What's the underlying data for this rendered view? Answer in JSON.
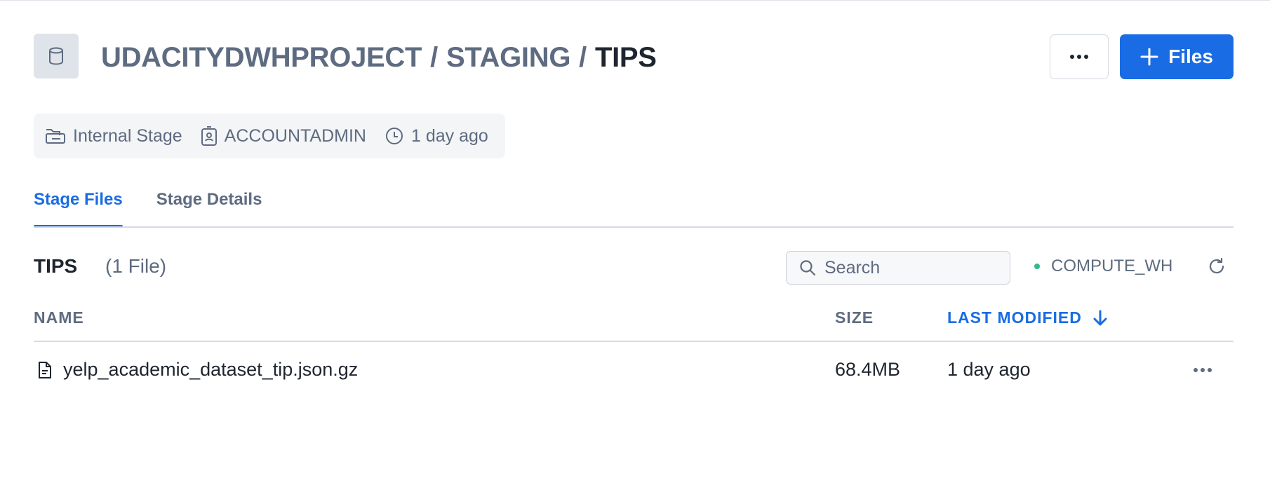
{
  "breadcrumb": {
    "database": "UDACITYDWHPROJECT",
    "separator": "/",
    "schema": "STAGING",
    "stage": "TIPS"
  },
  "header": {
    "database_icon": "database-icon",
    "more_icon": "ellipsis-icon",
    "add_files_label": "Files",
    "add_files_icon": "plus-icon"
  },
  "meta": {
    "stage_type": "Internal Stage",
    "owner": "ACCOUNTADMIN",
    "created": "1 day ago"
  },
  "tabs": [
    {
      "label": "Stage Files",
      "active": true
    },
    {
      "label": "Stage Details",
      "active": false
    }
  ],
  "list": {
    "title": "TIPS",
    "count": "(1 File)"
  },
  "search": {
    "placeholder": "Search",
    "value": ""
  },
  "warehouse": {
    "name": "COMPUTE_WH",
    "status_color": "#34b98a"
  },
  "table": {
    "columns": [
      {
        "label": "NAME"
      },
      {
        "label": "SIZE"
      },
      {
        "label": "LAST MODIFIED",
        "sorted": "descending"
      }
    ],
    "rows": [
      {
        "name": "yelp_academic_dataset_tip.json.gz",
        "size": "68.4MB",
        "modified": "1 day ago"
      }
    ]
  },
  "colors": {
    "accent": "#1a6ce4",
    "muted_text": "#5e6b80",
    "primary_text": "#1e252f"
  }
}
